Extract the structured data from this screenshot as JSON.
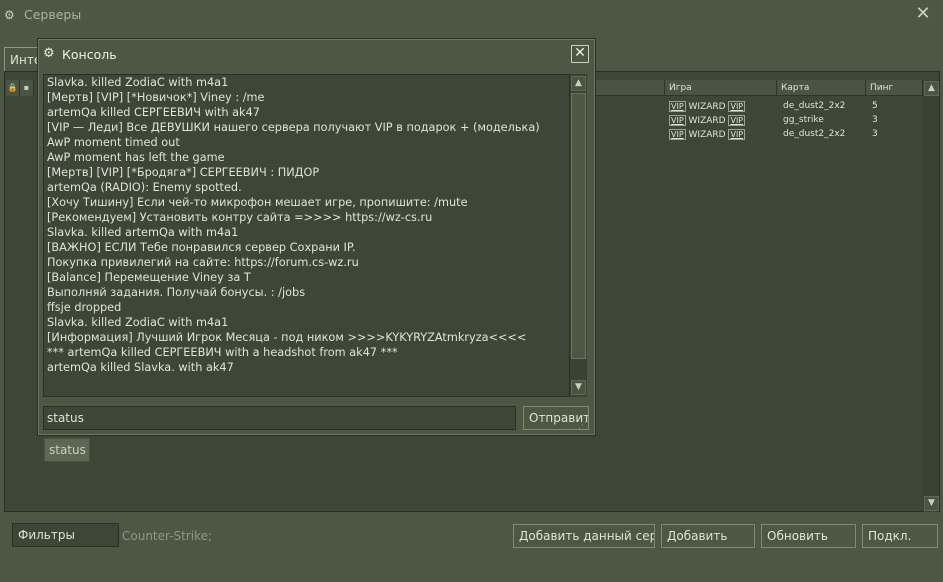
{
  "window": {
    "title": "Серверы",
    "tab_label": "Инте"
  },
  "columns": {
    "game": "Игра",
    "map": "Карта",
    "ping": "Пинг"
  },
  "servers": [
    {
      "game": "WIZARD",
      "map": "de_dust2_2x2",
      "ping": "5"
    },
    {
      "game": "WIZARD",
      "map": "gg_strike",
      "ping": "3"
    },
    {
      "game": "WIZARD",
      "map": "de_dust2_2x2",
      "ping": "3"
    }
  ],
  "vip_tag": "VIP",
  "footer": {
    "filters_label": "Фильтры",
    "game_filter": "Counter-Strike;",
    "add_current_label": "Добавить данный серве",
    "add_label": "Добавить",
    "refresh_label": "Обновить",
    "connect_label": "Подкл."
  },
  "console": {
    "title": "Консоль",
    "lines": [
      "Slavka. killed ZodiaC with m4a1",
      "[Мертв] [VIP] [*Новичок*] Viney : /me",
      "artemQa killed СЕРГЕЕВИЧ with ak47",
      "[VIP — Леди] Все ДЕВУШКИ нашего сервера получают VIP в подарок + (моделька)",
      "AwP moment timed out",
      "AwP moment has left the game",
      "[Мертв] [VIP] [*Бродяга*] СЕРГЕЕВИЧ : ПИДОР",
      "artemQa (RADIO): Enemy spotted.",
      "[Хочу Тишину] Если чей-то микрофон мешает игре, пропишите: /mute",
      "[Рекомендуем]  Установить контру сайта =>>>> https://wz-cs.ru",
      "Slavka. killed artemQa with m4a1",
      "[ВАЖНО] ЕСЛИ Тебе понравился сервер  Сохрани IP.",
      "Покупка привилегий на сайте: https://forum.cs-wz.ru",
      "[Balance] Перемещение Viney за T",
      "Выполняй задания. Получай бонусы. : /jobs",
      "ffsje dropped",
      "Slavka. killed ZodiaC with m4a1",
      "[Информация] Лучший Игрок Месяца   -    под ником >>>>KYKYRYZAtmkryza<<<<",
      "*** artemQa killed СЕРГЕЕВИЧ with a headshot from ak47 ***",
      "artemQa killed Slavka. with ak47"
    ],
    "command_value": "status",
    "send_label": "Отправить",
    "autocomplete_item": "status"
  },
  "icons": {
    "steam": "steam-icon",
    "close": "close-icon",
    "lock": "lock-icon",
    "scroll_up": "scroll-up-icon",
    "scroll_down": "scroll-down-icon"
  },
  "colors": {
    "background": "#4c5844",
    "panel": "#3e4637",
    "text": "#dfe3d8"
  }
}
